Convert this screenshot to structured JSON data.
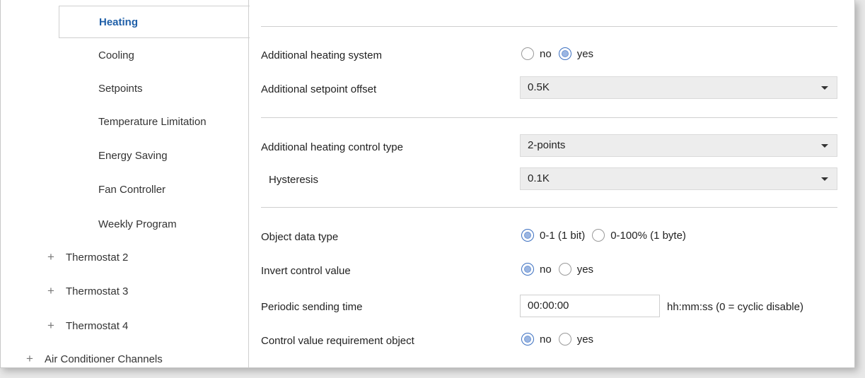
{
  "sidebar": {
    "items": [
      {
        "label": "Heating"
      },
      {
        "label": "Cooling"
      },
      {
        "label": "Setpoints"
      },
      {
        "label": "Temperature Limitation"
      },
      {
        "label": "Energy Saving"
      },
      {
        "label": "Fan Controller"
      },
      {
        "label": "Weekly Program"
      },
      {
        "label": "Thermostat 2",
        "expand": "+"
      },
      {
        "label": "Thermostat 3",
        "expand": "+"
      },
      {
        "label": "Thermostat 4",
        "expand": "+"
      },
      {
        "label": "Air Conditioner Channels",
        "expand": "+"
      }
    ]
  },
  "form": {
    "additional_heating_system": {
      "label": "Additional heating system",
      "options": [
        "no",
        "yes"
      ],
      "selected": "yes"
    },
    "additional_setpoint_offset": {
      "label": "Additional setpoint offset",
      "value": "0.5K"
    },
    "control_type": {
      "label": "Additional heating control type",
      "value": "2-points"
    },
    "hysteresis": {
      "label": "Hysteresis",
      "value": "0.1K"
    },
    "object_data_type": {
      "label": "Object data type",
      "options": [
        "0-1 (1 bit)",
        "0-100% (1 byte)"
      ],
      "selected": "0-1 (1 bit)"
    },
    "invert_control_value": {
      "label": "Invert control value",
      "options": [
        "no",
        "yes"
      ],
      "selected": "no"
    },
    "periodic_sending_time": {
      "label": "Periodic sending time",
      "value": "00:00:00",
      "suffix": "hh:mm:ss (0 = cyclic disable)"
    },
    "control_value_requirement": {
      "label": "Control value requirement object",
      "options": [
        "no",
        "yes"
      ],
      "selected": "no"
    }
  },
  "colors": {
    "active_nav": "#1f5fa8",
    "radio_accent": "#3b6fc0",
    "select_bg": "#ededed"
  }
}
